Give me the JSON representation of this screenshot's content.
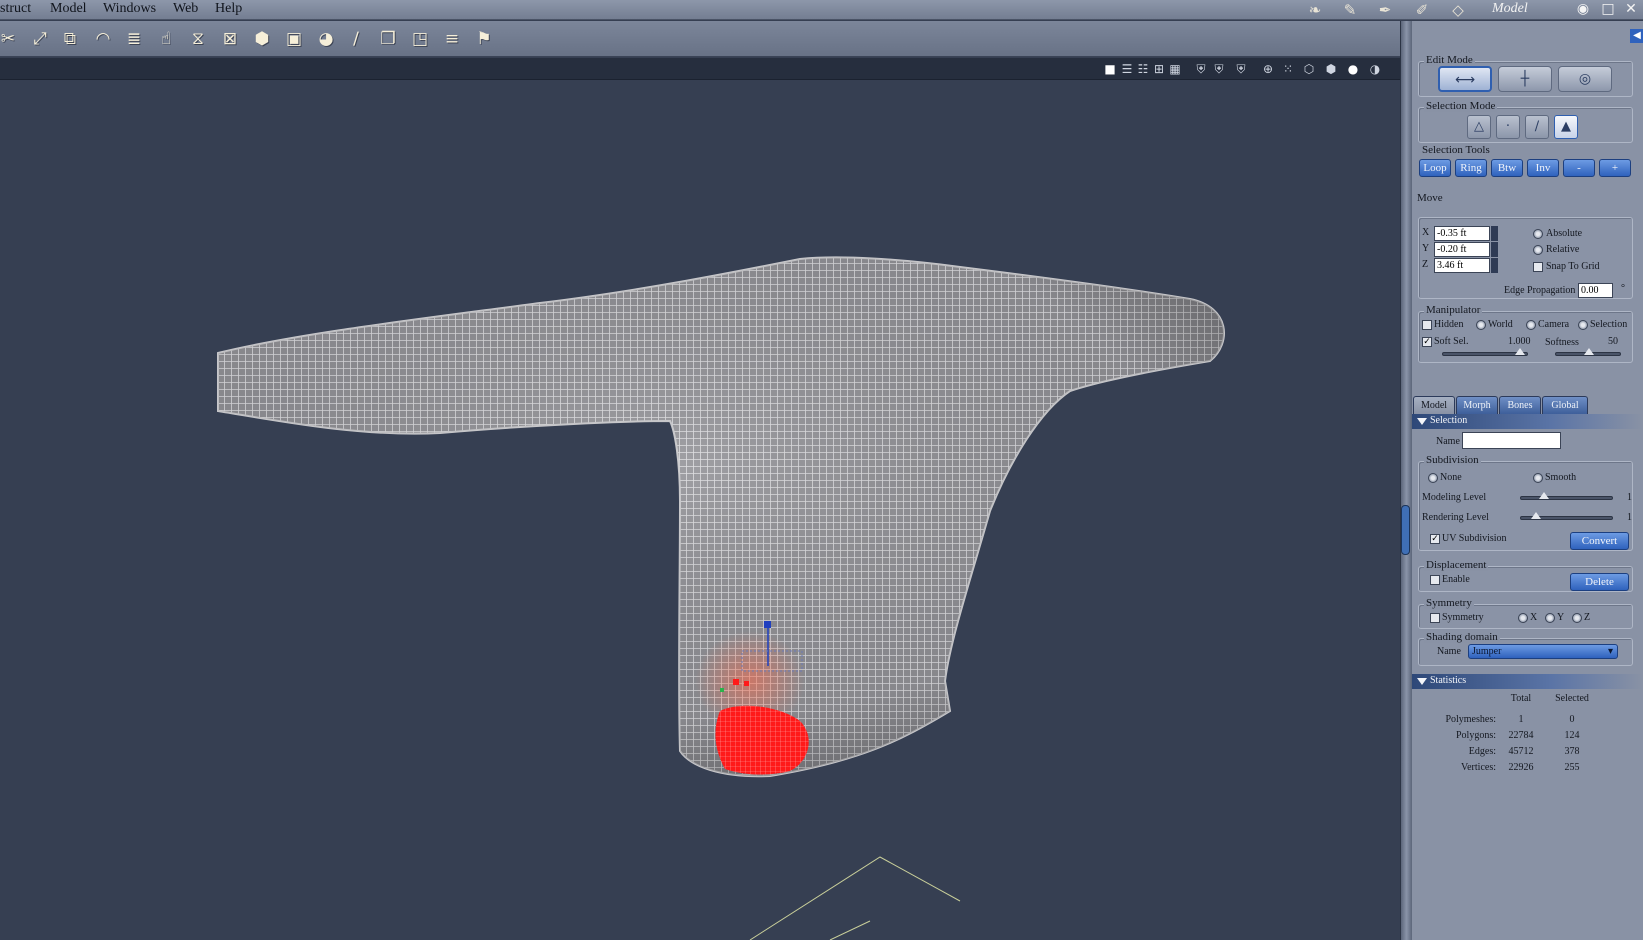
{
  "menubar": {
    "items": [
      "struct",
      "Model",
      "Windows",
      "Web",
      "Help"
    ],
    "room": "Model"
  },
  "panel": {
    "edit_mode": {
      "label": "Edit Mode"
    },
    "selection_mode": {
      "label": "Selection Mode"
    },
    "selection_tools": {
      "label": "Selection Tools",
      "buttons": [
        "Loop",
        "Ring",
        "Btw",
        "Inv",
        "-",
        "+"
      ]
    },
    "move": {
      "label": "Move",
      "x_label": "X",
      "x_value": "-0.35 ft",
      "y_label": "Y",
      "y_value": "-0.20 ft",
      "z_label": "Z",
      "z_value": "3.46 ft",
      "absolute": "Absolute",
      "relative": "Relative",
      "snap": "Snap To Grid",
      "edge_prop_label": "Edge Propagation",
      "edge_prop_value": "0.00",
      "edge_prop_unit": "°"
    },
    "manipulator": {
      "label": "Manipulator",
      "hidden": "Hidden",
      "world": "World",
      "camera": "Camera",
      "selection": "Selection",
      "soft_sel": "Soft Sel.",
      "soft_sel_value": "1.000",
      "softness": "Softness",
      "softness_value": "50"
    },
    "tabs": [
      "Model",
      "Morph",
      "Bones",
      "Global"
    ],
    "selection_section": {
      "header": "Selection",
      "name_label": "Name",
      "name_value": ""
    },
    "subdivision": {
      "label": "Subdivision",
      "none": "None",
      "smooth": "Smooth",
      "modeling_level": "Modeling Level",
      "modeling_value": "1",
      "rendering_level": "Rendering Level",
      "rendering_value": "1",
      "uv_subdivision": "UV Subdivision",
      "convert": "Convert"
    },
    "displacement": {
      "label": "Displacement",
      "enable": "Enable",
      "delete": "Delete"
    },
    "symmetry": {
      "label": "Symmetry",
      "symmetry": "Symmetry",
      "x": "X",
      "y": "Y",
      "z": "Z"
    },
    "shading": {
      "label": "Shading domain",
      "name_label": "Name",
      "value": "Jumper"
    },
    "statistics": {
      "header": "Statistics",
      "col_total": "Total",
      "col_selected": "Selected",
      "rows": [
        {
          "label": "Polymeshes:",
          "total": "1",
          "selected": "0"
        },
        {
          "label": "Polygons:",
          "total": "22784",
          "selected": "124"
        },
        {
          "label": "Edges:",
          "total": "45712",
          "selected": "378"
        },
        {
          "label": "Vertices:",
          "total": "22926",
          "selected": "255"
        }
      ]
    }
  },
  "icons": {
    "toolbar": [
      "scissors-icon",
      "scale-icon",
      "transform-icon",
      "dome-icon",
      "lathe-icon",
      "hand-icon",
      "goblet-icon",
      "box-icon",
      "cube-icon",
      "bag-icon",
      "sphere-icon",
      "brush-icon",
      "paper-icon",
      "fold-icon",
      "stack-icon",
      "pin-icon"
    ],
    "title_room": [
      "paint-room-icon",
      "pen-room-icon",
      "sculpt-room-icon",
      "model-room-icon"
    ]
  },
  "colors": {
    "viewport_bg": "#363f52",
    "selection_red": "#ff1a1a",
    "accent_blue": "#2f62bd"
  }
}
